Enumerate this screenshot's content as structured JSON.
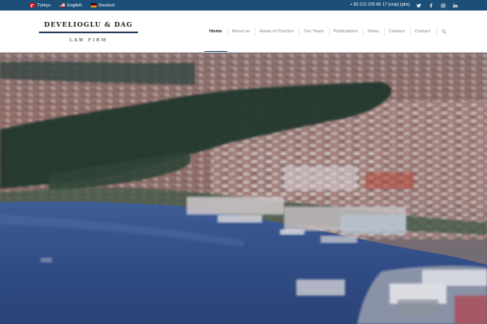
{
  "topbar": {
    "languages": [
      {
        "label": "Türkçe",
        "flag": "turkey-flag-icon"
      },
      {
        "label": "English",
        "flag": "uk-flag-icon"
      },
      {
        "label": "Deutsch",
        "flag": "germany-flag-icon"
      }
    ],
    "phone": "+ 90 212 225 66 17 (voip) (pbx)",
    "socials": [
      "twitter-icon",
      "facebook-icon",
      "instagram-icon",
      "linkedin-icon"
    ]
  },
  "logo": {
    "name": "DEVELIOGLU & DAG",
    "subtitle": "LAW FIRM"
  },
  "nav": {
    "items": [
      {
        "label": "Home",
        "active": true
      },
      {
        "label": "About us"
      },
      {
        "label": "Areas of Practice"
      },
      {
        "label": "Our Team"
      },
      {
        "label": "Publications"
      },
      {
        "label": "News"
      },
      {
        "label": "Careers"
      },
      {
        "label": "Contact"
      }
    ],
    "search_icon": "search-icon"
  },
  "hero": {
    "image": "istanbul-bosphorus-aerial-photo"
  },
  "colors": {
    "topbar": "#1b4f77",
    "accent": "#1b4f77",
    "nav_text": "#8a8a8a",
    "nav_active": "#222222"
  }
}
